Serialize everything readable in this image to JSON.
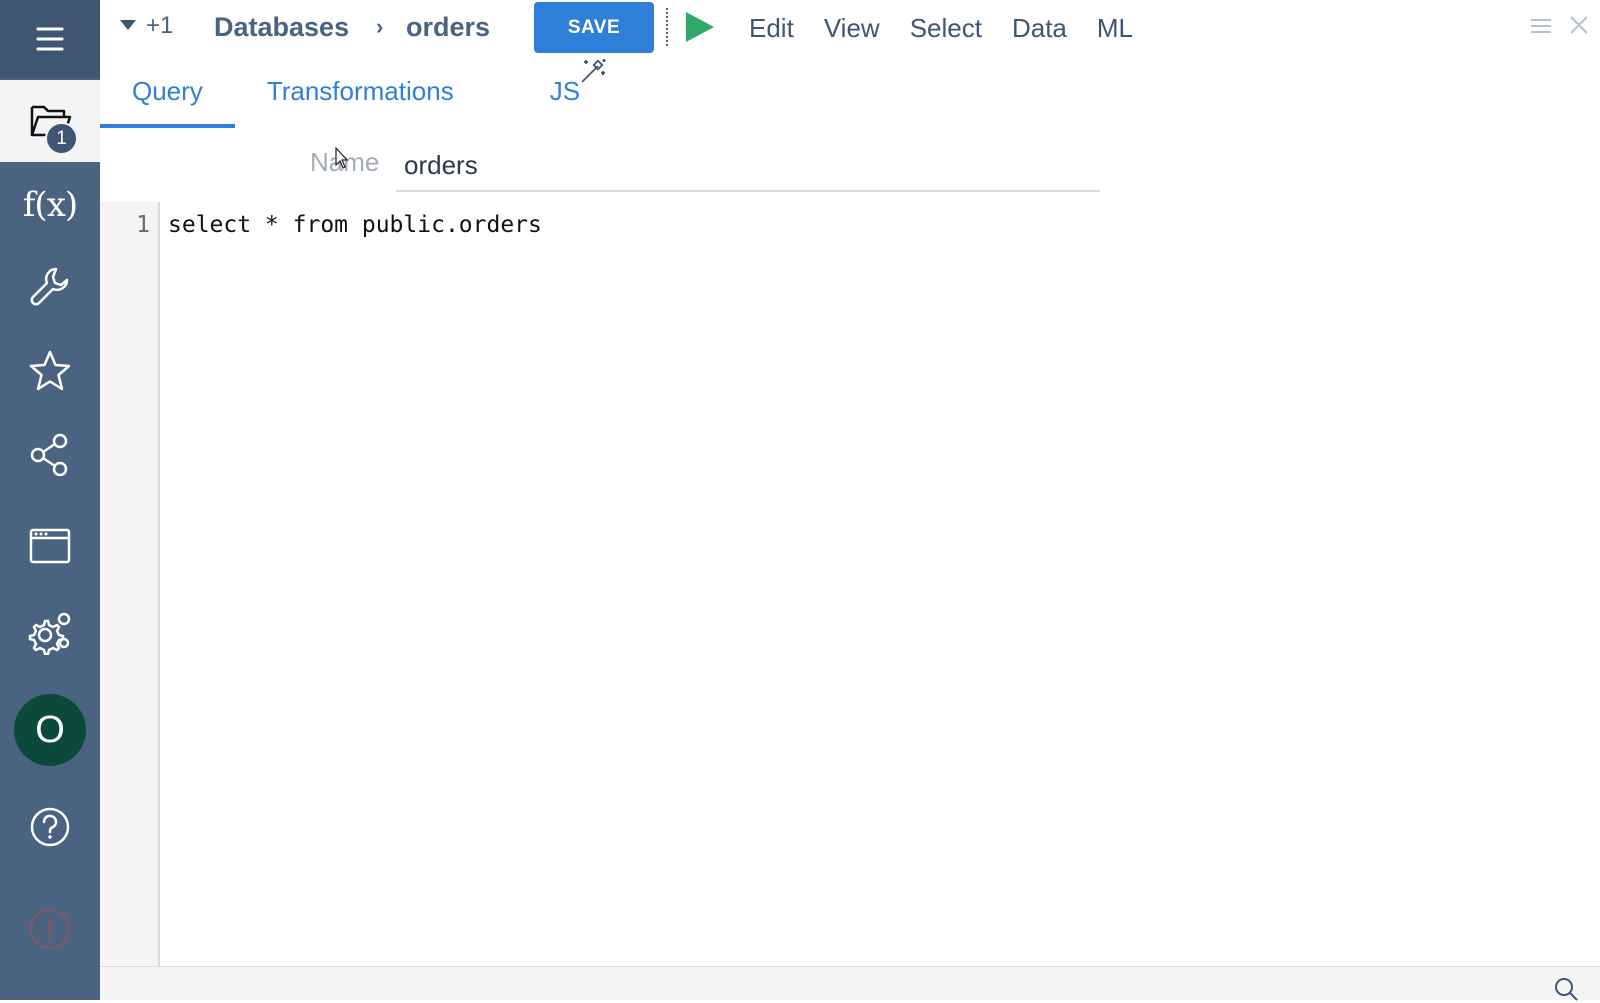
{
  "sidebar": {
    "items": [
      {
        "name": "menu",
        "icon": "hamburger-icon"
      },
      {
        "name": "browse",
        "icon": "folder-open-icon",
        "badge": "1"
      },
      {
        "name": "functions",
        "icon": "function-icon",
        "label": "f(x)"
      },
      {
        "name": "tools",
        "icon": "wrench-icon"
      },
      {
        "name": "favorites",
        "icon": "star-icon"
      },
      {
        "name": "share",
        "icon": "share-icon"
      },
      {
        "name": "windows",
        "icon": "browser-window-icon"
      },
      {
        "name": "settings",
        "icon": "gears-icon"
      },
      {
        "name": "user",
        "icon": "avatar",
        "initial": "O"
      },
      {
        "name": "help",
        "icon": "help-icon"
      },
      {
        "name": "alert",
        "icon": "alert-icon"
      }
    ]
  },
  "header": {
    "breadcrumb_more": "+1",
    "breadcrumb_parent": "Databases",
    "breadcrumb_current": "orders",
    "save_label": "SAVE",
    "menu": [
      "Edit",
      "View",
      "Select",
      "Data",
      "ML"
    ]
  },
  "tabs": [
    {
      "label": "Query",
      "active": true
    },
    {
      "label": "Transformations",
      "active": false
    },
    {
      "label": "JS",
      "active": false
    }
  ],
  "form": {
    "name_label": "Name",
    "name_value": "orders"
  },
  "editor": {
    "lines": [
      {
        "number": "1",
        "text": "select * from public.orders"
      }
    ]
  },
  "colors": {
    "sidebar": "#4a6380",
    "accent": "#2f7fd8",
    "run": "#2fa86a",
    "avatar": "#0b4a3b"
  }
}
